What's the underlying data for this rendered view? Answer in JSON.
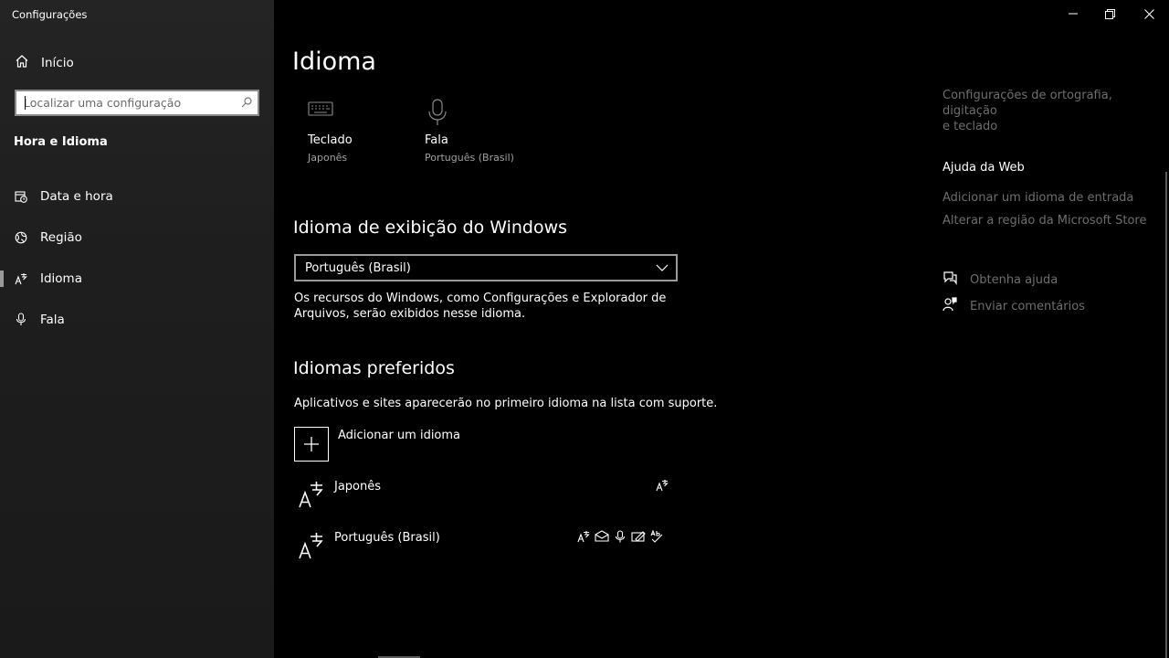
{
  "window": {
    "title": "Configurações"
  },
  "sidebar": {
    "home_label": "Início",
    "search_placeholder": "Localizar uma configuração",
    "section_title": "Hora e Idioma",
    "items": [
      {
        "label": "Data e hora",
        "icon": "calendar-clock-icon"
      },
      {
        "label": "Região",
        "icon": "globe-icon"
      },
      {
        "label": "Idioma",
        "icon": "language-icon",
        "active": true
      },
      {
        "label": "Fala",
        "icon": "microphone-icon"
      }
    ]
  },
  "main": {
    "title": "Idioma",
    "tiles": [
      {
        "label": "Teclado",
        "sub": "Japonês",
        "icon": "keyboard-icon"
      },
      {
        "label": "Fala",
        "sub": "Português (Brasil)",
        "icon": "microphone-icon"
      }
    ],
    "display_language": {
      "heading": "Idioma de exibição do Windows",
      "selected": "Português (Brasil)",
      "description_line1": "Os recursos do Windows, como Configurações e Explorador de",
      "description_line2": "Arquivos, serão exibidos nesse idioma."
    },
    "preferred": {
      "heading": "Idiomas preferidos",
      "description": "Aplicativos e sites aparecerão no primeiro idioma na lista com suporte.",
      "add_label": "Adicionar um idioma",
      "languages": [
        {
          "name": "Japonês",
          "features": [
            "display-language-icon"
          ]
        },
        {
          "name": "Português (Brasil)",
          "features": [
            "display-language-icon",
            "text-to-speech-icon",
            "speech-recognition-icon",
            "handwriting-icon",
            "spellcheck-icon"
          ]
        }
      ]
    }
  },
  "right": {
    "related_link": "Configurações de ortografia, digitação e teclado",
    "related_link_line1": "Configurações de ortografia, digitação",
    "related_link_line2": "e teclado",
    "web_help_heading": "Ajuda da Web",
    "web_links": [
      "Adicionar um idioma de entrada",
      "Alterar a região da Microsoft Store"
    ],
    "get_help": "Obtenha ajuda",
    "feedback": "Enviar comentários"
  },
  "colors": {
    "background": "#000000",
    "sidebar": "#1f1f1f",
    "muted_text": "#6e6e6e",
    "secondary_text": "#a0a0a0"
  }
}
